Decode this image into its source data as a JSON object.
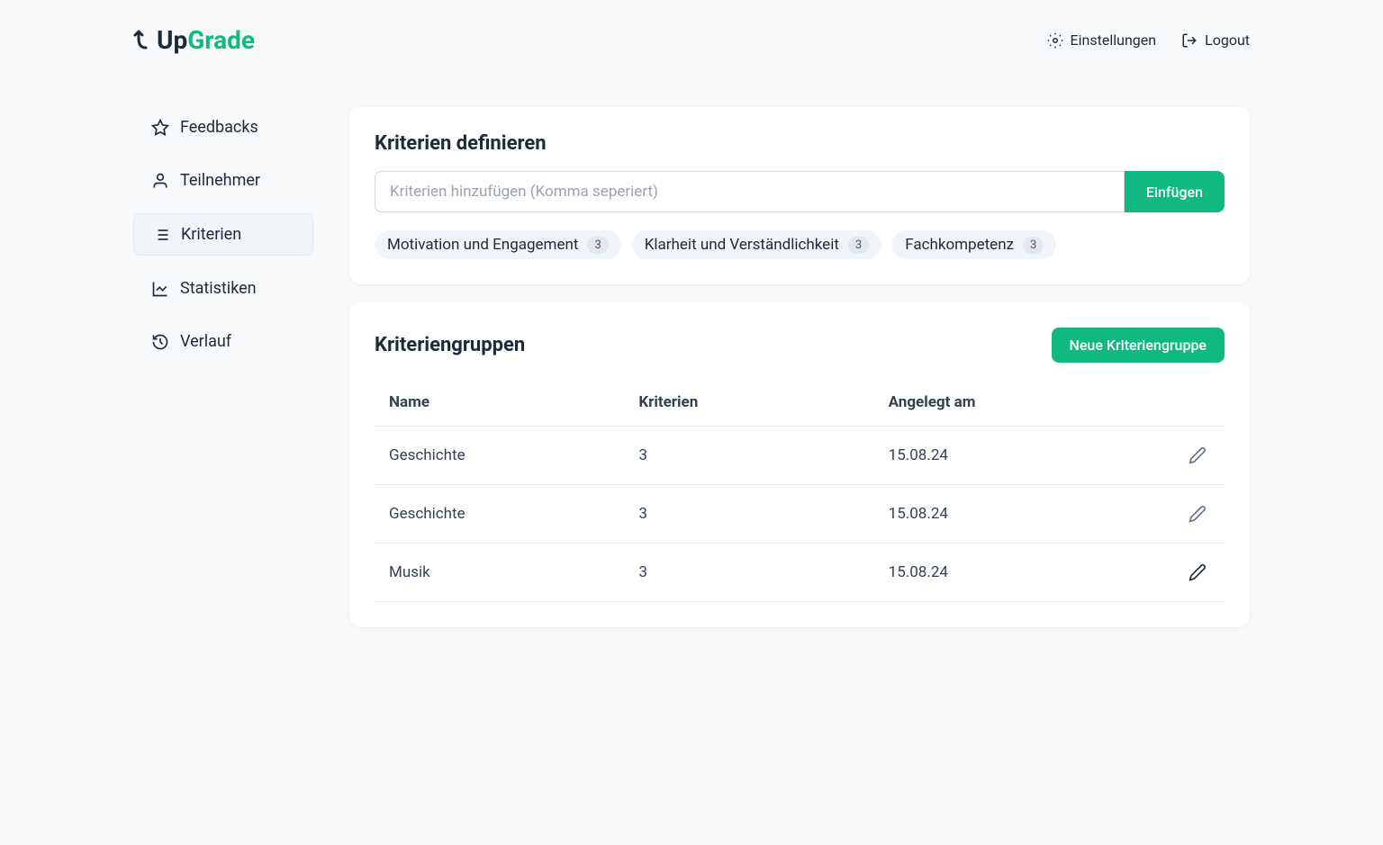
{
  "brand": {
    "up": "Up",
    "grade": "Grade"
  },
  "header": {
    "settings": "Einstellungen",
    "logout": "Logout"
  },
  "sidebar": {
    "items": [
      {
        "label": "Feedbacks",
        "icon": "star"
      },
      {
        "label": "Teilnehmer",
        "icon": "user"
      },
      {
        "label": "Kriterien",
        "icon": "list",
        "active": true
      },
      {
        "label": "Statistiken",
        "icon": "chart"
      },
      {
        "label": "Verlauf",
        "icon": "history"
      }
    ]
  },
  "criteria": {
    "title": "Kriterien definieren",
    "placeholder": "Kriterien hinzufügen (Komma seperiert)",
    "addButton": "Einfügen",
    "tags": [
      {
        "label": "Motivation und Engagement",
        "count": "3"
      },
      {
        "label": "Klarheit und Verständlichkeit",
        "count": "3"
      },
      {
        "label": "Fachkompetenz",
        "count": "3"
      }
    ]
  },
  "groups": {
    "title": "Kriteriengruppen",
    "newButton": "Neue Kriteriengruppe",
    "columns": {
      "name": "Name",
      "criteria": "Kriterien",
      "created": "Angelegt am"
    },
    "rows": [
      {
        "name": "Geschichte",
        "criteria": "3",
        "created": "15.08.24"
      },
      {
        "name": "Geschichte",
        "criteria": "3",
        "created": "15.08.24"
      },
      {
        "name": "Musik",
        "criteria": "3",
        "created": "15.08.24"
      }
    ]
  }
}
